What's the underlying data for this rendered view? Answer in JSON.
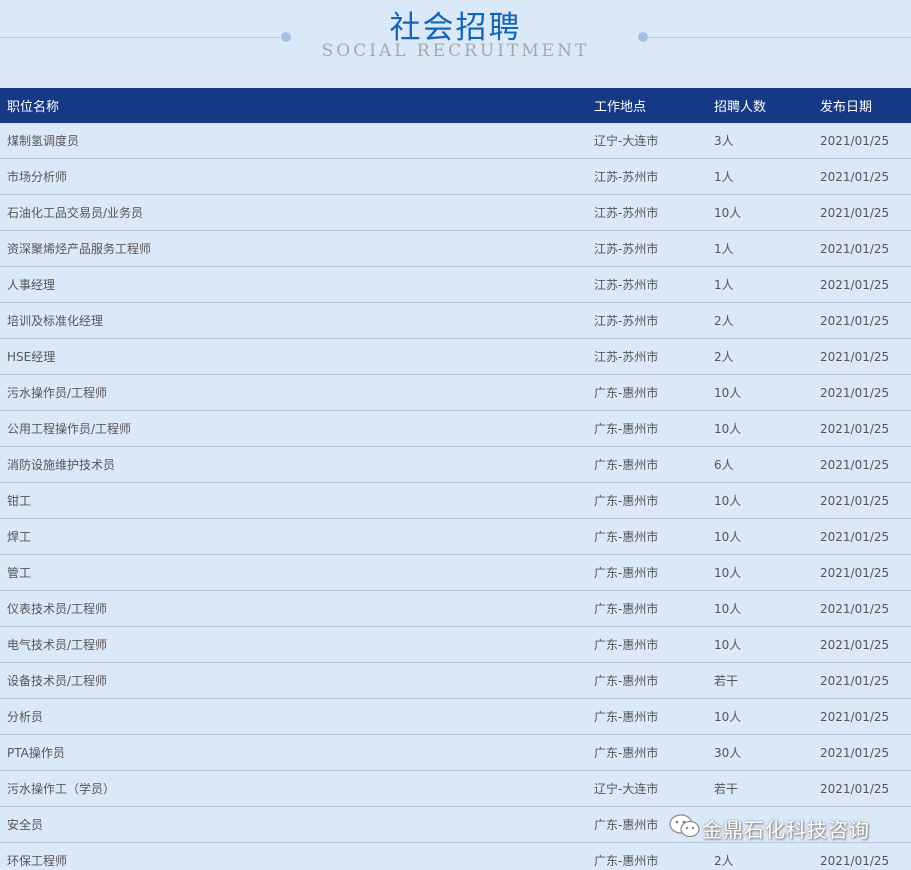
{
  "header": {
    "title": "社会招聘",
    "subtitle": "SOCIAL RECRUITMENT"
  },
  "table": {
    "columns": [
      "职位名称",
      "工作地点",
      "招聘人数",
      "发布日期"
    ],
    "rows": [
      [
        "煤制氢调度员",
        "辽宁-大连市",
        "3人",
        "2021/01/25"
      ],
      [
        "市场分析师",
        "江苏-苏州市",
        "1人",
        "2021/01/25"
      ],
      [
        "石油化工品交易员/业务员",
        "江苏-苏州市",
        "10人",
        "2021/01/25"
      ],
      [
        "资深聚烯烃产品服务工程师",
        "江苏-苏州市",
        "1人",
        "2021/01/25"
      ],
      [
        "人事经理",
        "江苏-苏州市",
        "1人",
        "2021/01/25"
      ],
      [
        "培训及标准化经理",
        "江苏-苏州市",
        "2人",
        "2021/01/25"
      ],
      [
        "HSE经理",
        "江苏-苏州市",
        "2人",
        "2021/01/25"
      ],
      [
        "污水操作员/工程师",
        "广东-惠州市",
        "10人",
        "2021/01/25"
      ],
      [
        "公用工程操作员/工程师",
        "广东-惠州市",
        "10人",
        "2021/01/25"
      ],
      [
        "消防设施维护技术员",
        "广东-惠州市",
        "6人",
        "2021/01/25"
      ],
      [
        "钳工",
        "广东-惠州市",
        "10人",
        "2021/01/25"
      ],
      [
        "焊工",
        "广东-惠州市",
        "10人",
        "2021/01/25"
      ],
      [
        "管工",
        "广东-惠州市",
        "10人",
        "2021/01/25"
      ],
      [
        "仪表技术员/工程师",
        "广东-惠州市",
        "10人",
        "2021/01/25"
      ],
      [
        "电气技术员/工程师",
        "广东-惠州市",
        "10人",
        "2021/01/25"
      ],
      [
        "设备技术员/工程师",
        "广东-惠州市",
        "若干",
        "2021/01/25"
      ],
      [
        "分析员",
        "广东-惠州市",
        "10人",
        "2021/01/25"
      ],
      [
        "PTA操作员",
        "广东-惠州市",
        "30人",
        "2021/01/25"
      ],
      [
        "污水操作工（学员）",
        "辽宁-大连市",
        "若干",
        "2021/01/25"
      ],
      [
        "安全员",
        "广东-惠州市",
        "",
        ""
      ],
      [
        "环保工程师",
        "广东-惠州市",
        "2人",
        "2021/01/25"
      ]
    ]
  },
  "watermark": {
    "text": "金鼎石化科技咨询",
    "icon": "wechat-icon"
  }
}
